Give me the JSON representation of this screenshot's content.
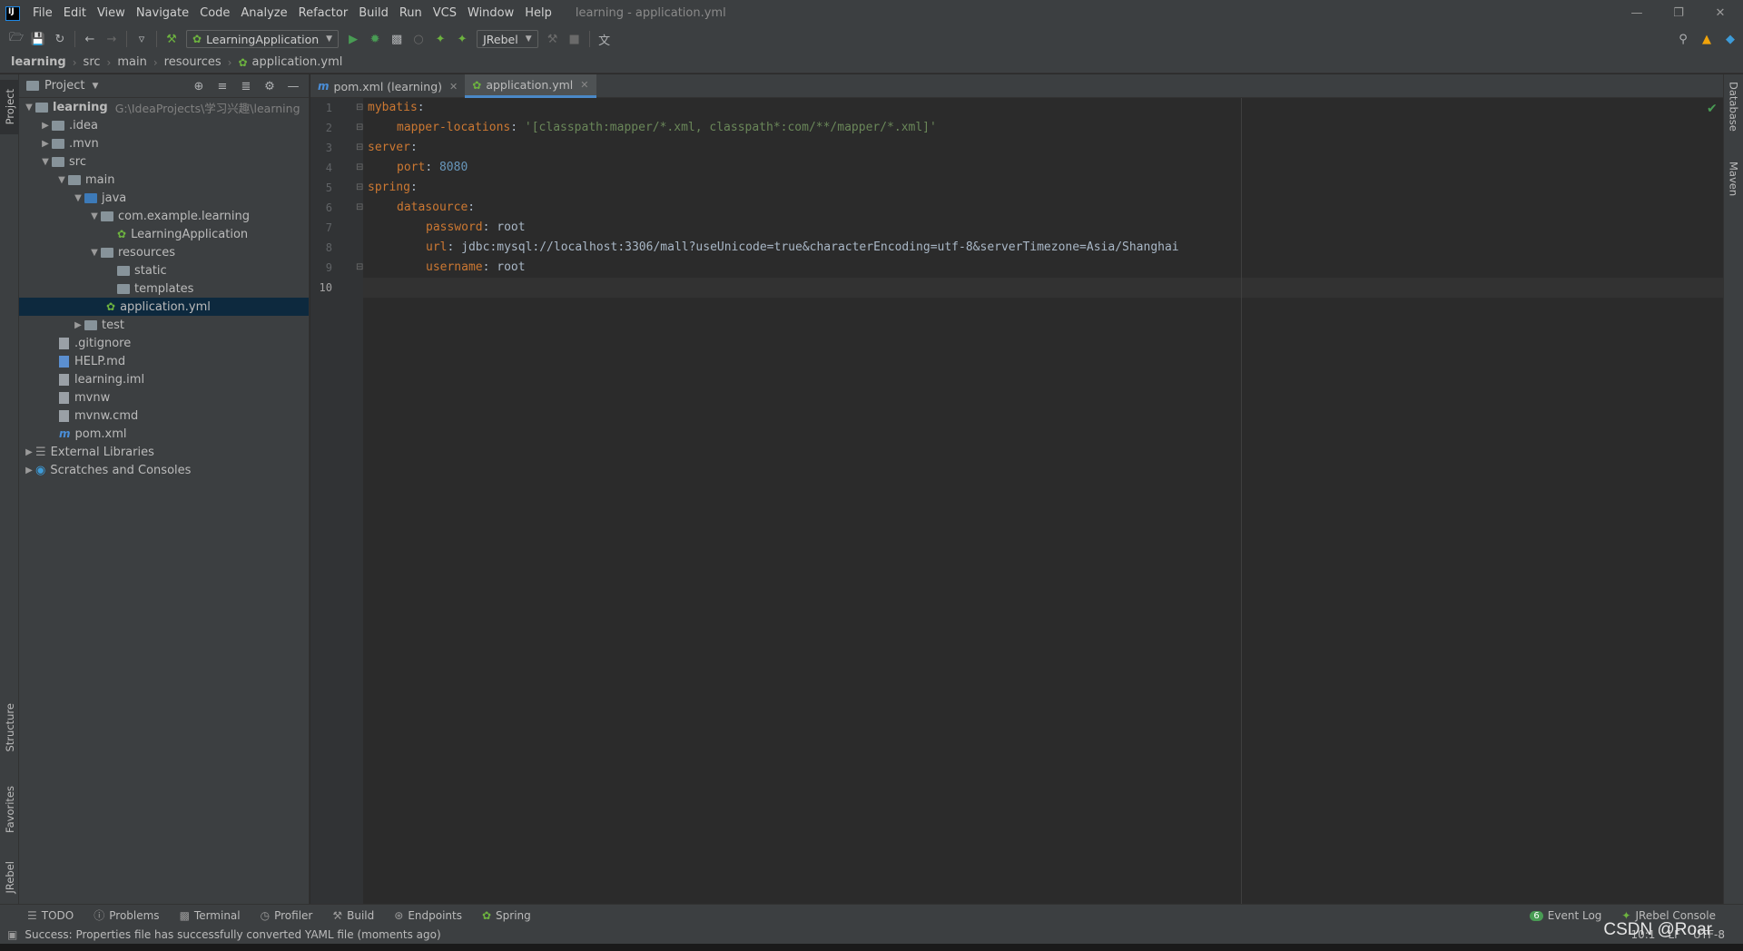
{
  "app": {
    "window_title": "learning - application.yml",
    "menu": [
      "File",
      "Edit",
      "View",
      "Navigate",
      "Code",
      "Analyze",
      "Refactor",
      "Build",
      "Run",
      "VCS",
      "Window",
      "Help"
    ]
  },
  "toolbar": {
    "run_config": "LearningApplication",
    "jrebel": "JRebel"
  },
  "breadcrumb": [
    "learning",
    "src",
    "main",
    "resources",
    "application.yml"
  ],
  "project_panel": {
    "title": "Project",
    "tree": [
      {
        "label": "learning",
        "hint": "G:\\IdeaProjects\\学习兴趣\\learning"
      },
      {
        "label": ".idea"
      },
      {
        "label": ".mvn"
      },
      {
        "label": "src"
      },
      {
        "label": "main"
      },
      {
        "label": "java"
      },
      {
        "label": "com.example.learning"
      },
      {
        "label": "LearningApplication"
      },
      {
        "label": "resources"
      },
      {
        "label": "static"
      },
      {
        "label": "templates"
      },
      {
        "label": "application.yml"
      },
      {
        "label": "test"
      },
      {
        "label": ".gitignore"
      },
      {
        "label": "HELP.md"
      },
      {
        "label": "learning.iml"
      },
      {
        "label": "mvnw"
      },
      {
        "label": "mvnw.cmd"
      },
      {
        "label": "pom.xml"
      },
      {
        "label": "External Libraries"
      },
      {
        "label": "Scratches and Consoles"
      }
    ]
  },
  "editor": {
    "tabs": [
      {
        "label": "pom.xml (learning)"
      },
      {
        "label": "application.yml"
      }
    ],
    "lines": [
      {
        "no": "1",
        "key": "mybatis",
        "value": ""
      },
      {
        "no": "2",
        "key": "mapper-locations",
        "value": "'[classpath:mapper/*.xml, classpath*:com/**/mapper/*.xml]'"
      },
      {
        "no": "3",
        "key": "server",
        "value": ""
      },
      {
        "no": "4",
        "key": "port",
        "value": "8080"
      },
      {
        "no": "5",
        "key": "spring",
        "value": ""
      },
      {
        "no": "6",
        "key": "datasource",
        "value": ""
      },
      {
        "no": "7",
        "key": "password",
        "value": "root"
      },
      {
        "no": "8",
        "key": "url",
        "value": "jdbc:mysql://localhost:3306/mall?useUnicode=true&characterEncoding=utf-8&serverTimezone=Asia/Shanghai"
      },
      {
        "no": "9",
        "key": "username",
        "value": "root"
      },
      {
        "no": "10",
        "key": "",
        "value": ""
      }
    ]
  },
  "left_strip": [
    "Project",
    "Structure",
    "Favorites",
    "JRebel"
  ],
  "right_strip": [
    "Database",
    "Maven"
  ],
  "bottom_tools": [
    "TODO",
    "Problems",
    "Terminal",
    "Profiler",
    "Build",
    "Endpoints",
    "Spring"
  ],
  "bottom_right_tools": [
    "Event Log",
    "JRebel Console"
  ],
  "status": {
    "message": "Success: Properties file has successfully converted YAML file (moments ago)",
    "position": "10:1",
    "line_sep": "LF",
    "encoding": "UTF-8",
    "event_count": "6"
  },
  "watermark": "CSDN @Roar",
  "colors": {
    "keyword": "#cc7832",
    "string": "#6a8759",
    "number": "#6897bb",
    "selection": "#0d293e"
  }
}
